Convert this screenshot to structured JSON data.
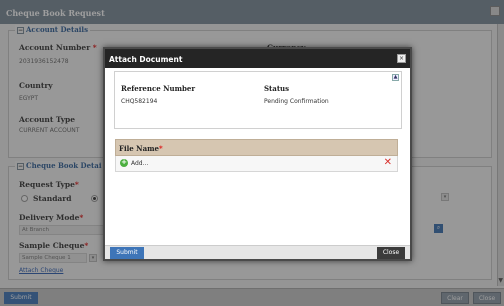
{
  "window": {
    "title": "Cheque Book Request",
    "account_details": {
      "legend": "Account Details",
      "account_number_label": "Account Number",
      "account_number_value": "2031936152478",
      "currency_label": "Currency",
      "country_label": "Country",
      "country_value": "EGYPT",
      "account_type_label": "Account Type",
      "account_type_value": "CURRENT ACCOUNT"
    },
    "cheque_book_details": {
      "legend": "Cheque Book Detai",
      "request_type_label": "Request Type",
      "request_type_options": [
        "Standard"
      ],
      "delivery_mode_label": "Delivery Mode",
      "delivery_mode_value": "At Branch",
      "sample_cheque_label": "Sample Cheque",
      "sample_cheque_value": "Sample Cheque 1",
      "attach_link": "Attach Cheque"
    },
    "bottom": {
      "submit": "Submit",
      "clear": "Clear",
      "close": "Close"
    }
  },
  "modal": {
    "title": "Attach Document",
    "reference_header": "Reference Number",
    "status_header": "Status",
    "reference_value": "CHQ582194",
    "status_value": "Pending Confirmation",
    "file_name_header": "File Name",
    "add_label": "Add...",
    "submit": "Submit",
    "close": "Close"
  },
  "colors": {
    "accent": "#3e75b8",
    "title_bar": "#7a8a98",
    "modal_title": "#252525",
    "file_header": "#d6c6b1",
    "remove": "#d8302c",
    "add": "#4caf3f"
  }
}
